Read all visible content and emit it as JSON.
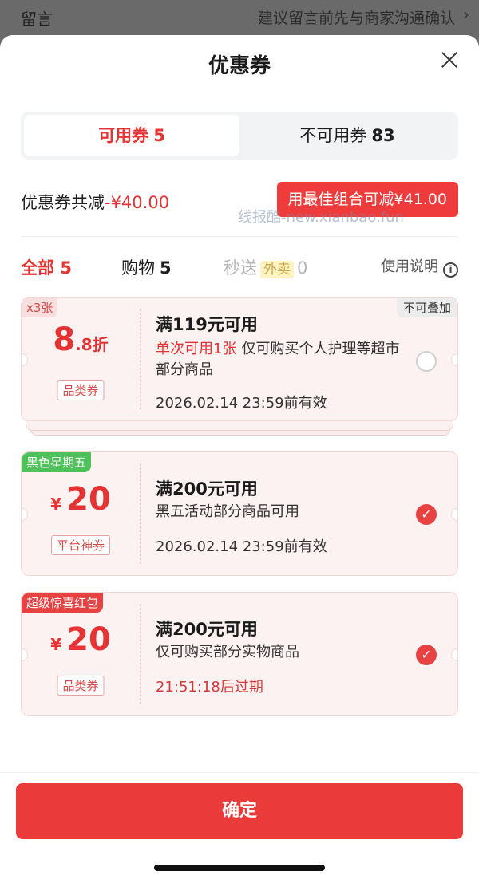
{
  "backdrop": {
    "left_label": "留言",
    "right_label": "建议留言前先与商家沟通确认",
    "chevron": "›"
  },
  "sheet": {
    "title": "优惠券"
  },
  "tabs": [
    {
      "label": "可用券",
      "count": "5"
    },
    {
      "label": "不可用券",
      "count": "83"
    }
  ],
  "summary": {
    "label": "优惠券共减",
    "amount": "-¥40.00",
    "best_combo": "用最佳组合可减¥41.00"
  },
  "watermark": "线报酷-new.xianbao.fun",
  "filters": {
    "all": {
      "label": "全部",
      "count": "5"
    },
    "shopping": {
      "label": "购物",
      "count": "5"
    },
    "fast": {
      "label": "秒送",
      "tag": "外卖",
      "count": "0"
    },
    "help": "使用说明",
    "help_icon": "i"
  },
  "coupons": [
    {
      "corner": "x3张",
      "corner_right": "不可叠加",
      "value_big": "8",
      "value_small": ".8折",
      "badge": "品类券",
      "condition": "满119元可用",
      "highlight": "单次可用1张",
      "desc": "仅可购买个人护理等超市部分商品",
      "expiry": "2026.02.14 23:59前有效",
      "selected": false
    },
    {
      "corner": "黑色星期五",
      "currency": "¥",
      "value_big": "20",
      "badge": "平台神券",
      "condition": "满200元可用",
      "desc": "黑五活动部分商品可用",
      "expiry": "2026.02.14 23:59前有效",
      "selected": true
    },
    {
      "corner": "超级惊喜红包",
      "currency": "¥",
      "value_big": "20",
      "badge": "品类券",
      "condition": "满200元可用",
      "desc": "仅可购买部分实物商品",
      "expiry": "21:51:18后过期",
      "selected": true
    }
  ],
  "check_glyph": "✓",
  "confirm_label": "确定",
  "colors": {
    "accent": "#e84141",
    "coupon_bg": "#fdf2f2",
    "green_tag": "#4fc15a"
  }
}
